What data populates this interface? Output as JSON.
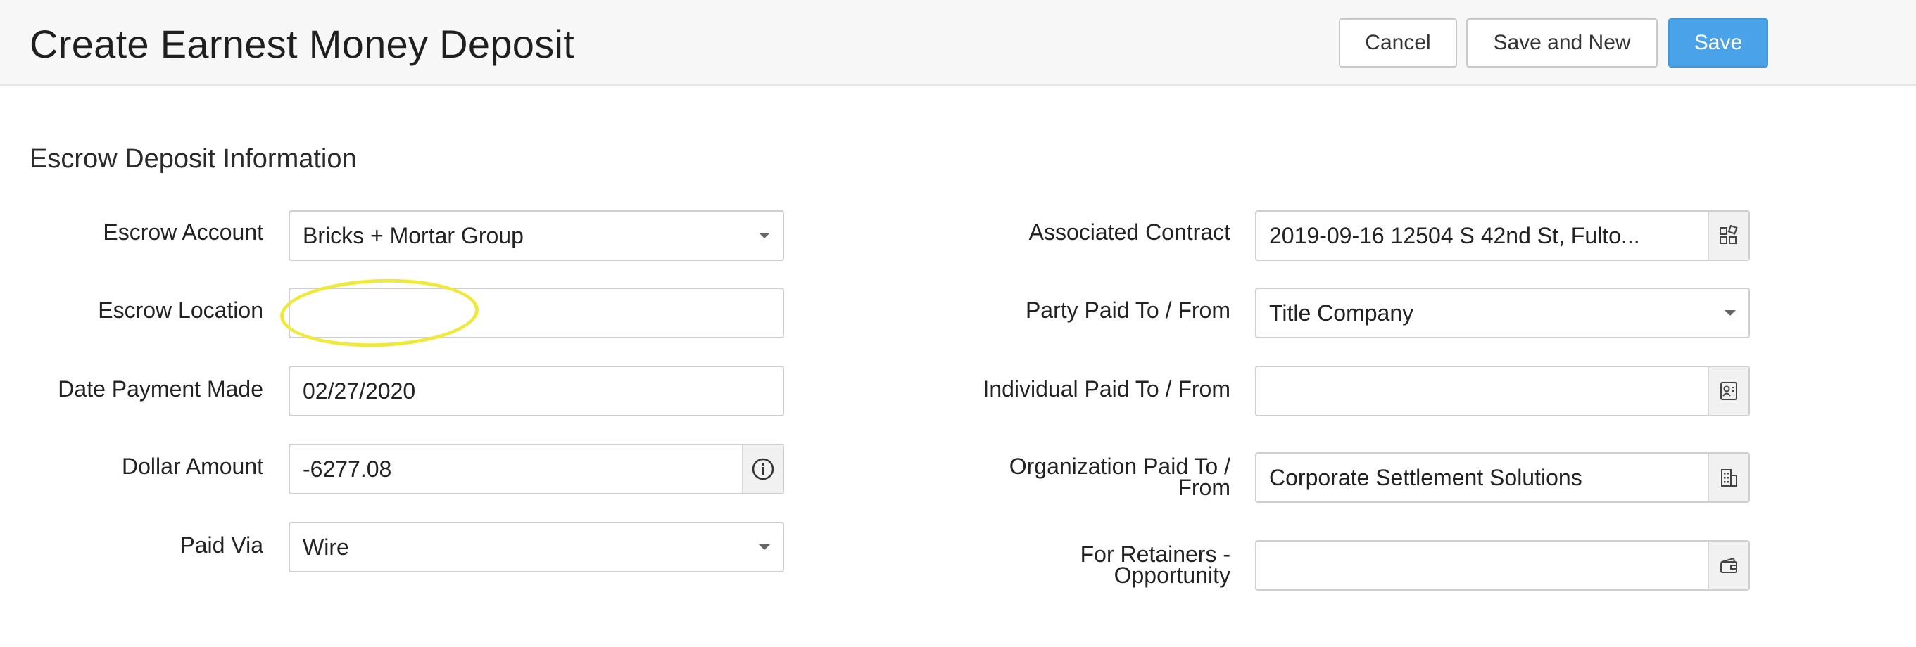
{
  "header": {
    "title": "Create Earnest Money Deposit",
    "cancel_label": "Cancel",
    "save_new_label": "Save and New",
    "save_label": "Save"
  },
  "section": {
    "title": "Escrow Deposit Information"
  },
  "left_fields": {
    "escrow_account": {
      "label": "Escrow Account",
      "value": "Bricks + Mortar Group"
    },
    "escrow_location": {
      "label": "Escrow Location",
      "value": ""
    },
    "date_payment_made": {
      "label": "Date Payment Made",
      "value": "02/27/2020"
    },
    "dollar_amount": {
      "label": "Dollar Amount",
      "value": "-6277.08"
    },
    "paid_via": {
      "label": "Paid Via",
      "value": "Wire"
    }
  },
  "right_fields": {
    "associated_contract": {
      "label": "Associated Contract",
      "value": "2019-09-16 12504 S 42nd St, Fulto..."
    },
    "party_paid": {
      "label": "Party Paid To / From",
      "value": "Title Company"
    },
    "individual_paid": {
      "label": "Individual Paid To / From",
      "value": ""
    },
    "organization_paid": {
      "label_line1": "Organization Paid To /",
      "label_line2": "From",
      "value": "Corporate Settlement Solutions"
    },
    "retainers": {
      "label_line1": "For Retainers -",
      "label_line2": "Opportunity",
      "value": ""
    }
  },
  "colors": {
    "primary_button": "#4aa3e8",
    "highlight": "#f0e93a"
  },
  "icons": {
    "contract": "lookup-grid-icon",
    "individual": "contact-card-icon",
    "organization": "building-icon",
    "retainers": "wallet-icon",
    "info": "info-icon"
  }
}
